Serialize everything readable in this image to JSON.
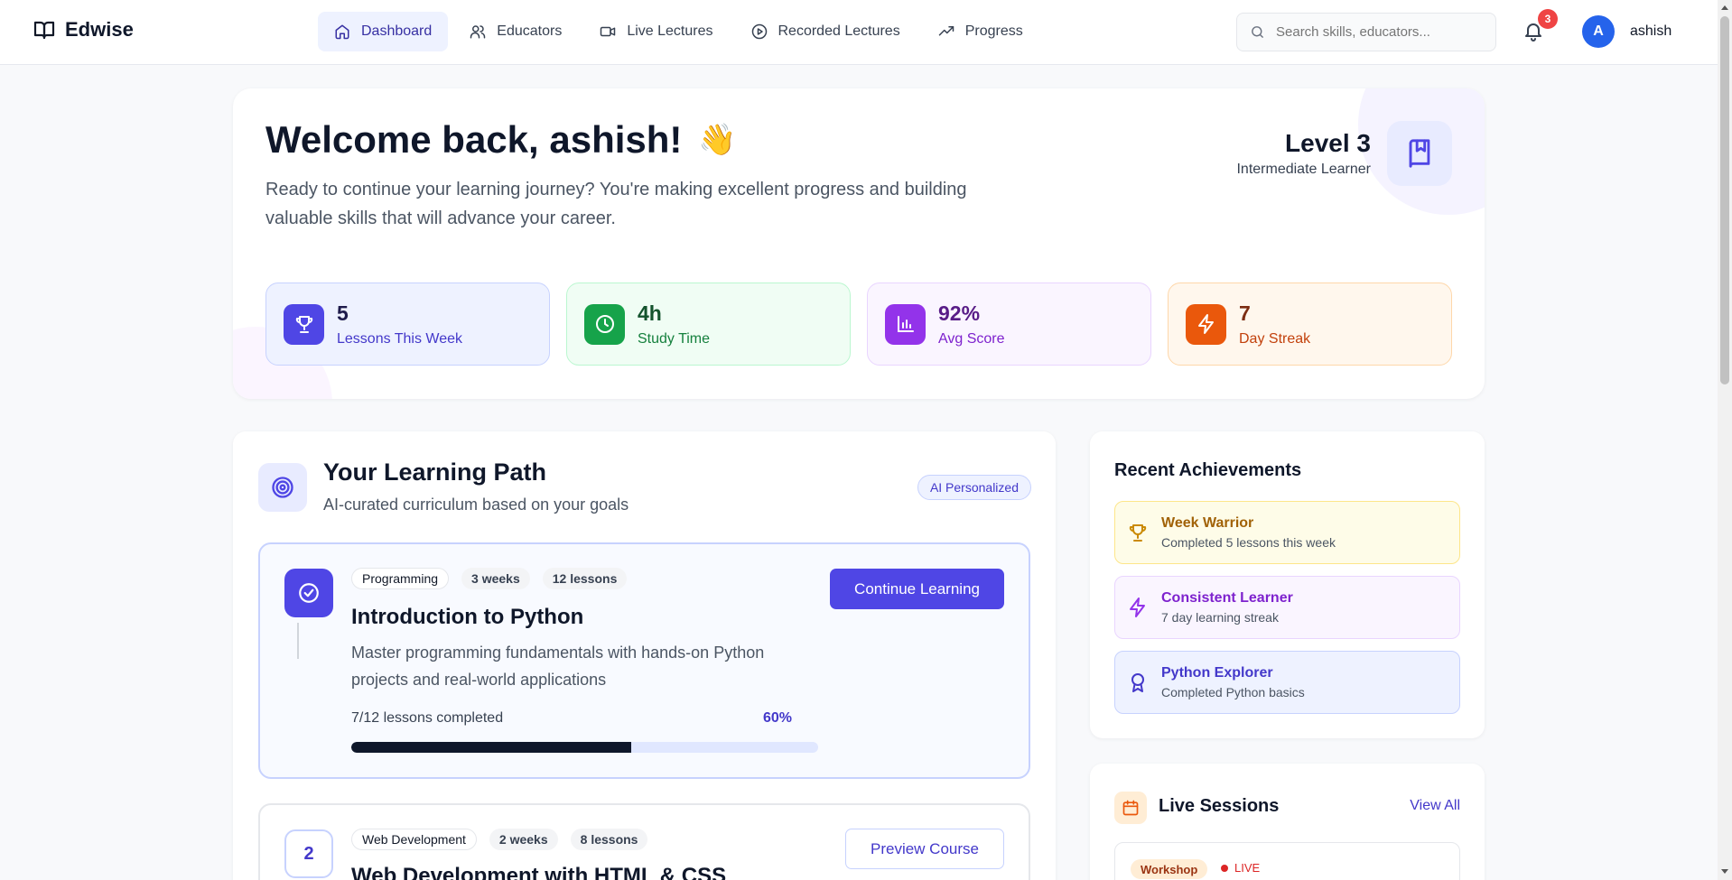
{
  "brand": {
    "name": "Edwise"
  },
  "nav": {
    "items": [
      {
        "label": "Dashboard",
        "icon": "home-icon"
      },
      {
        "label": "Educators",
        "icon": "users-icon"
      },
      {
        "label": "Live Lectures",
        "icon": "video-icon"
      },
      {
        "label": "Recorded Lectures",
        "icon": "play-circle-icon"
      },
      {
        "label": "Progress",
        "icon": "trending-up-icon"
      }
    ],
    "active": "Dashboard"
  },
  "search": {
    "placeholder": "Search skills, educators..."
  },
  "notifications": {
    "count": "3"
  },
  "user": {
    "initial": "A",
    "name": "ashish"
  },
  "hero": {
    "greeting": "Welcome back, ashish!",
    "wave": "👋",
    "subtitle": "Ready to continue your learning journey? You're making excellent progress and building valuable skills that will advance your career.",
    "level": "Level 3",
    "level_label": "Intermediate Learner"
  },
  "stats": [
    {
      "value": "5",
      "label": "Lessons This Week",
      "icon": "trophy-icon"
    },
    {
      "value": "4h",
      "label": "Study Time",
      "icon": "clock-icon"
    },
    {
      "value": "92%",
      "label": "Avg Score",
      "icon": "bar-chart-icon"
    },
    {
      "value": "7",
      "label": "Day Streak",
      "icon": "lightning-icon"
    }
  ],
  "learning_path": {
    "title": "Your Learning Path",
    "subtitle": "AI-curated curriculum based on your goals",
    "badge": "AI Personalized",
    "courses": [
      {
        "category": "Programming",
        "duration": "3 weeks",
        "lessons": "12 lessons",
        "title": "Introduction to Python",
        "description": "Master programming fundamentals with hands-on Python projects and real-world applications",
        "progress_label": "7/12 lessons completed",
        "progress_pct": "60%",
        "progress_fraction": 0.6,
        "action": "Continue Learning"
      },
      {
        "number": "2",
        "category": "Web Development",
        "duration": "2 weeks",
        "lessons": "8 lessons",
        "title": "Web Development with HTML & CSS",
        "action": "Preview Course"
      }
    ]
  },
  "achievements": {
    "title": "Recent Achievements",
    "items": [
      {
        "name": "Week Warrior",
        "description": "Completed 5 lessons this week",
        "icon": "trophy-icon"
      },
      {
        "name": "Consistent Learner",
        "description": "7 day learning streak",
        "icon": "lightning-icon"
      },
      {
        "name": "Python Explorer",
        "description": "Completed Python basics",
        "icon": "award-icon"
      }
    ]
  },
  "live_sessions": {
    "title": "Live Sessions",
    "view_all": "View All",
    "items": [
      {
        "type": "Workshop",
        "status": "LIVE"
      }
    ]
  }
}
